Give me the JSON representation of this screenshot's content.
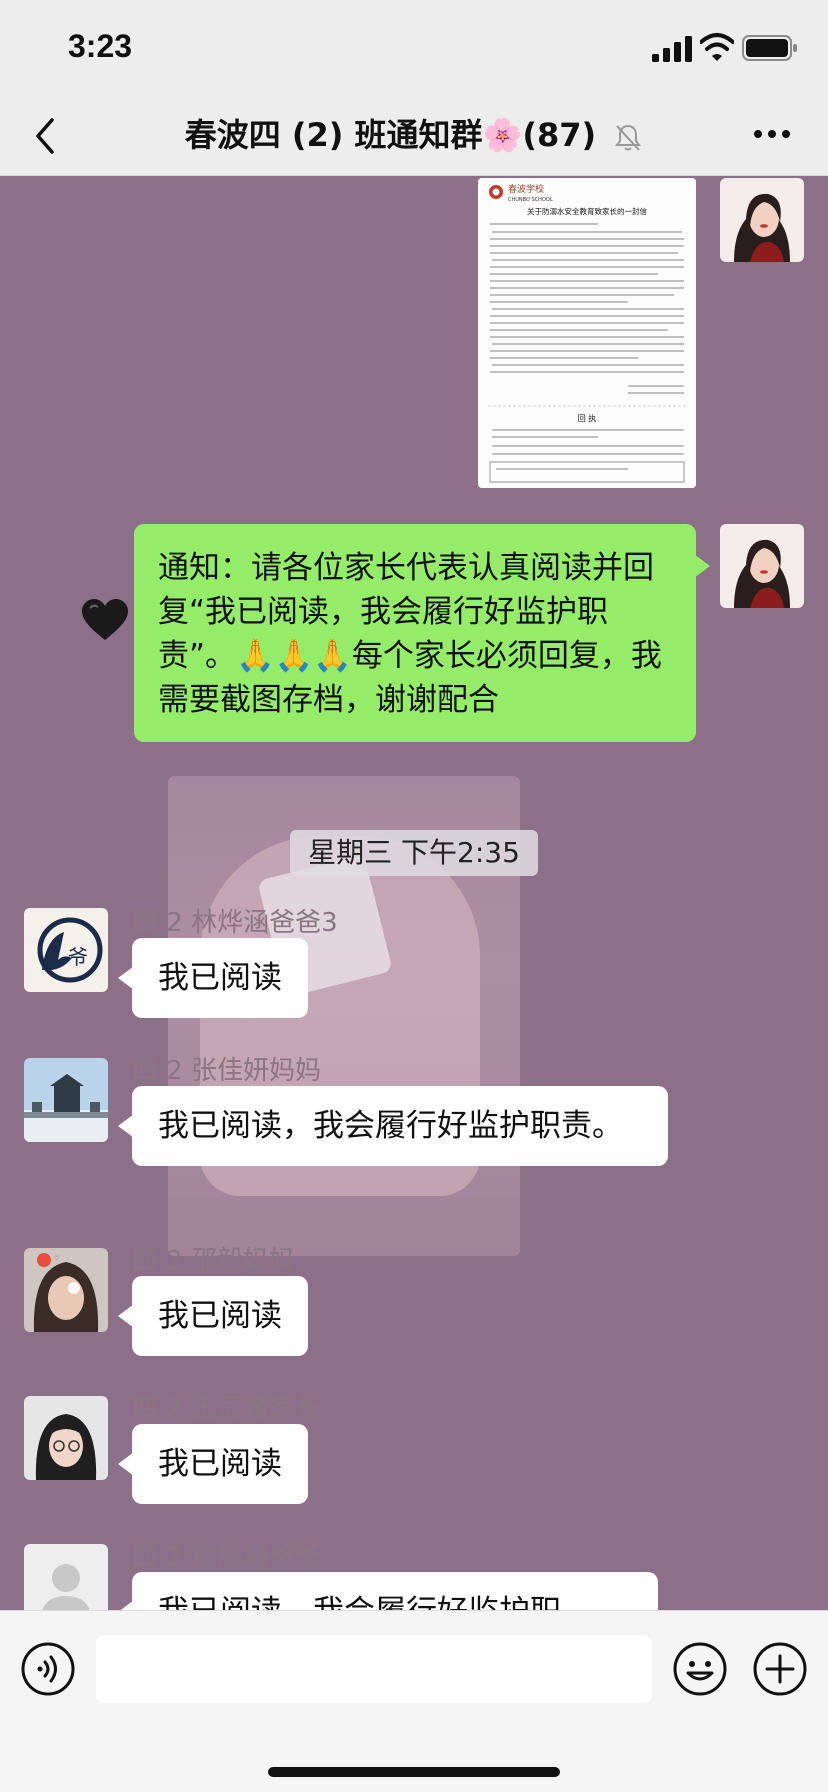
{
  "status_bar": {
    "time": "3:23"
  },
  "nav": {
    "title": "春波四 (2) 班通知群🌸(87)",
    "back_icon": "chevron-left-icon",
    "more_icon": "more-dots-icon",
    "mute_icon": "muted-bell-icon"
  },
  "document": {
    "school_name": "春波学校",
    "school_name_en": "CHUNBO SCHOOL",
    "heading": "关于防溺水安全教育致家长的一封信",
    "receipt_title": "回 执"
  },
  "teacher_message": {
    "text": "通知：请各位家长代表认真阅读并回复“我已阅读，我会履行好监护职责”。🙏🙏🙏每个家长必须回复，我需要截图存档，谢谢配合"
  },
  "timestamp": "星期三 下午2:35",
  "messages": [
    {
      "sender": "四 2 林烨涵爸爸3",
      "text": "我已阅读"
    },
    {
      "sender": "四 2 张佳妍妈妈",
      "text": " 我已阅读，我会履行好监护职责。"
    },
    {
      "sender": "四 2 邵毅妈妈",
      "text": "我已阅读"
    },
    {
      "sender": "四 2 王冠希家长",
      "text": "我已阅读"
    },
    {
      "sender": "四 2 詹晨瑞爷爷",
      "text": "我已阅读，我会履行好监护职"
    }
  ],
  "input_bar": {
    "placeholder": "",
    "voice_icon": "voice-icon",
    "emoji_icon": "emoji-icon",
    "plus_icon": "plus-icon"
  },
  "colors": {
    "chat_background": "#8c7089",
    "outgoing_bubble": "#95ec69",
    "incoming_bubble": "#ffffff",
    "bar_background": "#ededed"
  }
}
